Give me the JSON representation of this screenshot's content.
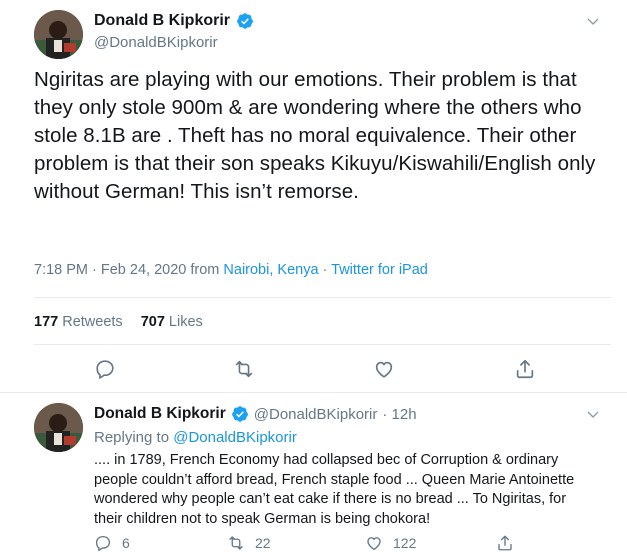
{
  "main_tweet": {
    "display_name": "Donald B Kipkorir",
    "handle": "@DonaldBKipkorir",
    "text": "Ngiritas are playing with our emotions. Their problem is that they only stole 900m & are wondering where the others who stole 8.1B are . Theft has no moral equivalence. Their other problem is that their son speaks Kikuyu/Kiswahili/English only without German! This isn’t remorse.",
    "time": "7:18 PM · Feb 24, 2020 from ",
    "location": "Nairobi, Kenya",
    "separator": " · ",
    "source": "Twitter for iPad",
    "retweets_count": "177",
    "retweets_label": "Retweets",
    "likes_count": "707",
    "likes_label": "Likes"
  },
  "reply_tweet": {
    "display_name": "Donald B Kipkorir",
    "handle": "@DonaldBKipkorir",
    "dot_time": "· 12h",
    "replying_prefix": "Replying to ",
    "replying_to": "@DonaldBKipkorir",
    "text": ".... in 1789, French Economy had collapsed bec of Corruption & ordinary people couldn’t afford bread, French staple food ... Queen Marie Antoinette wondered why people can’t eat cake if there is no bread ... To Ngiritas, for their children not to speak German is being chokora!",
    "reply_count": "6",
    "retweet_count": "22",
    "like_count": "122"
  },
  "colors": {
    "accent": "#1b95e0",
    "verified": "#1da1f2",
    "secondary_text": "#657786",
    "divider": "#e6ecf0"
  },
  "icons": [
    "verified-badge-icon",
    "chevron-down-icon",
    "reply-icon",
    "retweet-icon",
    "like-icon",
    "share-icon"
  ]
}
